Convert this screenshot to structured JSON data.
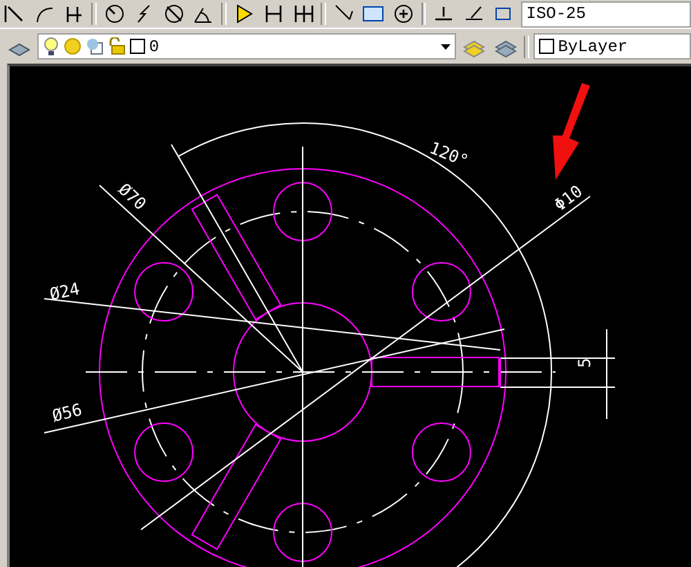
{
  "toolbar": {
    "dimension_style": "ISO-25"
  },
  "layer_bar": {
    "layer": "0",
    "color_setting": "ByLayer"
  },
  "drawing": {
    "labels": [
      {
        "text": "120°"
      },
      {
        "text": "Ø70"
      },
      {
        "text": "Ø24"
      },
      {
        "text": "Ø56"
      },
      {
        "text": "Φ10"
      },
      {
        "text": "5"
      }
    ]
  }
}
